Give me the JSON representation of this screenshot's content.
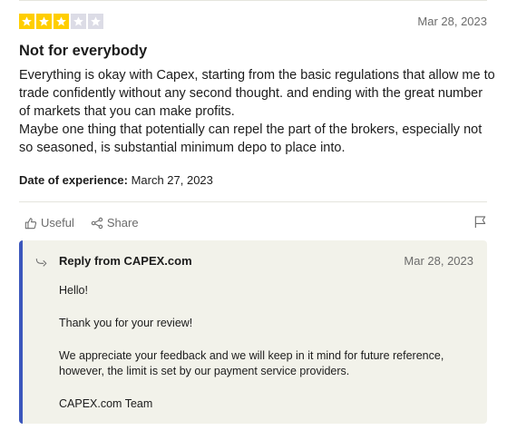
{
  "review": {
    "rating": 3,
    "max_rating": 5,
    "star_colors": {
      "filled": "#ffce00",
      "empty": "#dcdce6",
      "glyph": "#ffffff"
    },
    "date": "Mar 28, 2023",
    "title": "Not for everybody",
    "paragraphs": [
      "Everything is okay with Capex, starting from the basic regulations that allow me to trade confidently without any second thought. and ending with the great number of markets that you can make profits.",
      "Maybe one thing that potentially can repel the part of the brokers, especially not so seasoned, is substantial minimum depo to place into."
    ],
    "experience_label": "Date of experience:",
    "experience_date": "March 27, 2023"
  },
  "actions": {
    "useful_label": "Useful",
    "share_label": "Share"
  },
  "reply": {
    "from": "Reply from CAPEX.com",
    "date": "Mar 28, 2023",
    "paragraphs": [
      "Hello!",
      "Thank you for your review!",
      "We appreciate your feedback and we will keep in it mind for future reference, however, the limit is set by our payment service providers.",
      "CAPEX.com Team"
    ],
    "accent_color": "#3c57bc",
    "background_color": "#f2f2ea"
  }
}
